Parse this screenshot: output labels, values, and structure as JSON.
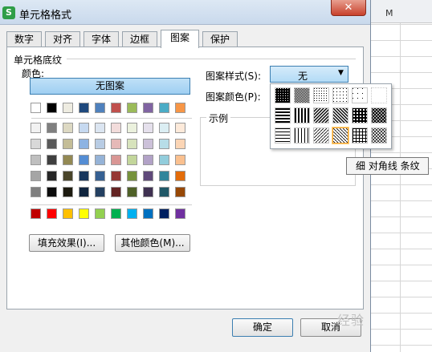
{
  "app_icon_letter": "S",
  "dialog_title": "单元格格式",
  "close_glyph": "✕",
  "sheet_column_letter": "M",
  "tabs": [
    {
      "label": "数字"
    },
    {
      "label": "对齐"
    },
    {
      "label": "字体"
    },
    {
      "label": "边框"
    },
    {
      "label": "图案"
    },
    {
      "label": "保护"
    }
  ],
  "active_tab": "图案",
  "shading_group": {
    "legend": "单元格底纹",
    "color_label": "颜色:",
    "no_pattern_label": "无图案",
    "theme_top_row": [
      "#ffffff",
      "#000000",
      "#eeece1",
      "#1f497d",
      "#4f81bd",
      "#c0504d",
      "#9bbb59",
      "#8064a2",
      "#4bacc6",
      "#f79646"
    ],
    "theme_shades": [
      [
        "#f2f2f2",
        "#7f7f7f",
        "#ddd9c3",
        "#c6d9f0",
        "#dbe5f1",
        "#f2dcdb",
        "#ebf1dd",
        "#e5e0ec",
        "#dbeef3",
        "#fdeada"
      ],
      [
        "#d8d8d8",
        "#595959",
        "#c4bd97",
        "#8db3e2",
        "#b8cce4",
        "#e5b9b7",
        "#d7e3bc",
        "#ccc1d9",
        "#b7dde8",
        "#fbd5b5"
      ],
      [
        "#bfbfbf",
        "#3f3f3f",
        "#938953",
        "#548dd4",
        "#95b3d7",
        "#d99694",
        "#c3d69b",
        "#b2a2c7",
        "#92cddc",
        "#fac08f"
      ],
      [
        "#a5a5a5",
        "#262626",
        "#494429",
        "#17365d",
        "#366092",
        "#953734",
        "#76923c",
        "#5f497a",
        "#31859b",
        "#e36c09"
      ],
      [
        "#7f7f7f",
        "#0c0c0c",
        "#1d1b10",
        "#0f243e",
        "#244061",
        "#632423",
        "#4f6128",
        "#3f3151",
        "#205867",
        "#974806"
      ]
    ],
    "standard_colors": [
      "#c00000",
      "#ff0000",
      "#ffc000",
      "#ffff00",
      "#92d050",
      "#00b050",
      "#00b0f0",
      "#0070c0",
      "#002060",
      "#7030a0"
    ],
    "fill_effects_label": "填充效果(I)...",
    "more_colors_label": "其他颜色(M)..."
  },
  "pattern": {
    "style_label": "图案样式(S):",
    "style_value": "无",
    "color_label": "图案颜色(P):",
    "sample_label": "示例"
  },
  "tooltip": "细 对角线 条纹",
  "ok_label": "确定",
  "cancel_label": "取消",
  "watermark": "经验"
}
